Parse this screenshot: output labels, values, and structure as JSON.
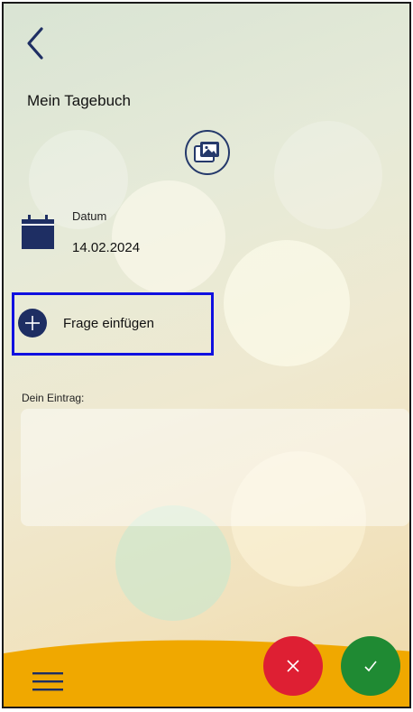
{
  "header": {
    "back_icon": "chevron-left-icon",
    "title": "Mein Tagebuch",
    "image_icon": "photo-gallery-icon"
  },
  "date": {
    "icon": "calendar-icon",
    "label": "Datum",
    "value": "14.02.2024"
  },
  "question": {
    "icon": "plus-circle-icon",
    "label": "Frage einfügen"
  },
  "entry": {
    "label": "Dein Eintrag:",
    "value": ""
  },
  "footer": {
    "menu_icon": "hamburger-menu-icon",
    "cancel_icon": "close-icon",
    "confirm_icon": "check-icon"
  },
  "colors": {
    "accent": "#1e2e63",
    "highlight": "#1010e0",
    "bar": "#f0a800",
    "cancel": "#de1f33",
    "confirm": "#1f8a33"
  }
}
